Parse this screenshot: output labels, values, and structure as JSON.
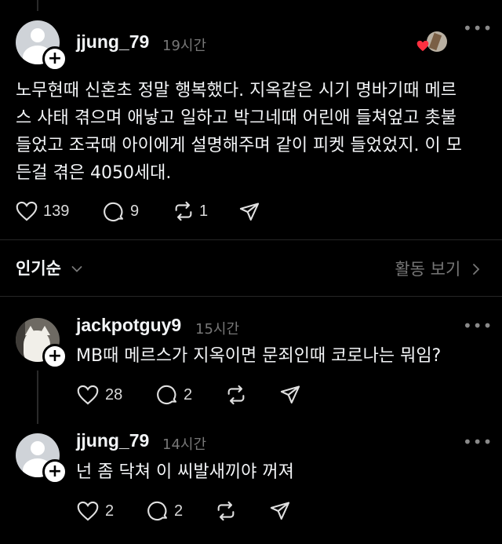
{
  "original_post": {
    "username": "jjung_79",
    "time": "19시간",
    "text_lines": [
      "노무현때 신혼초 정말 행복했다. 지옥같은 시기 명바기때 메르",
      "스 사태 겪으며 애낳고 일하고 박그네때 어린애 들쳐엎고 촛불",
      "들었고 조국때 아이에게 설명해주며 같이 피켓 들었었지. 이 모",
      "든걸 겪은 4050세대."
    ],
    "likes": "139",
    "replies": "9",
    "reposts": "1"
  },
  "sort_bar": {
    "label": "인기순",
    "activity": "활동 보기"
  },
  "reply1": {
    "username": "jackpotguy9",
    "time": "15시간",
    "text": "MB때 메르스가 지옥이면 문죄인때 코로나는 뭐임?",
    "likes": "28",
    "replies": "2"
  },
  "reply2": {
    "username": "jjung_79",
    "time": "14시간",
    "text": "넌 좀 닥쳐 이 씨발새끼야 꺼져",
    "likes": "2",
    "replies": "2"
  },
  "icons": {
    "like": "heart-icon",
    "reply": "comment-icon",
    "repost": "repost-icon",
    "share": "share-icon",
    "more": "more-icon",
    "sort": "chevron-down-icon",
    "activity": "chevron-right-icon"
  },
  "colors": {
    "background": "#000000",
    "text": "#f3f5f7",
    "muted": "#777777",
    "heart_badge": "#ff3040"
  }
}
